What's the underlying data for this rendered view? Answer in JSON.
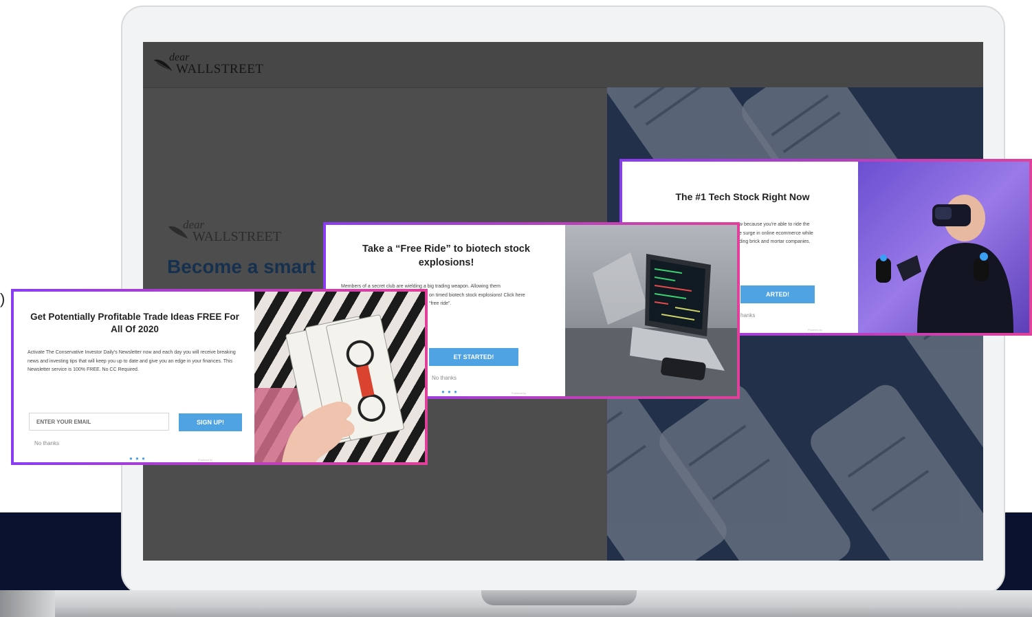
{
  "colors": {
    "navy_band": "#0b1230",
    "popup_border_start": "#8a3df0",
    "popup_border_end": "#e0409a",
    "cta_blue": "#4fa3e3",
    "hero_text": "#16304f"
  },
  "screen": {
    "logo": {
      "dear": "dear",
      "wallstreet": "WALLSTREET"
    },
    "hero": {
      "logo": {
        "dear": "dear",
        "wallstreet": "WALLSTREET"
      },
      "headline_visible": "Become a smart"
    }
  },
  "cut_text": ")",
  "popup_trade": {
    "title": "Get Potentially Profitable Trade Ideas FREE For All Of 2020",
    "body": "Activate The Conservative Investor Daily's Newsletter now and each day you will receive breaking news and investing tips that will keep you up to date and give you an edge in your finances. This Newsletter service is 100% FREE. No CC Required.",
    "email_placeholder": "ENTER YOUR EMAIL",
    "button": "SIGN UP!",
    "dismiss": "No thanks",
    "dots": "● ● ●",
    "powered": "Powered by",
    "photo_icon": "money-in-hand-photo"
  },
  "popup_biotech": {
    "title": "Take a “Free Ride” to biotech stock explosions!",
    "body_line1": "Members of a secret club are wielding a big trading weapon. Allowing them",
    "body_line2": "on timed biotech stock explosions! Click here",
    "body_line3": "“free ride”.",
    "button": "ET STARTED!",
    "dismiss": "No thanks",
    "dots": "● ● ●",
    "powered": "Powered by",
    "photo_icon": "laptop-code-photo"
  },
  "popup_tech": {
    "title": "The #1 Tech Stock Right Now",
    "body_line1": "w because you're able to ride the",
    "body_line2": "e surge in online ecommerce while",
    "body_line3": "ding brick and mortar companies.",
    "button": "ARTED!",
    "dismiss": "hanks",
    "powered": "Powered by",
    "photo_icon": "vr-headset-photo"
  }
}
